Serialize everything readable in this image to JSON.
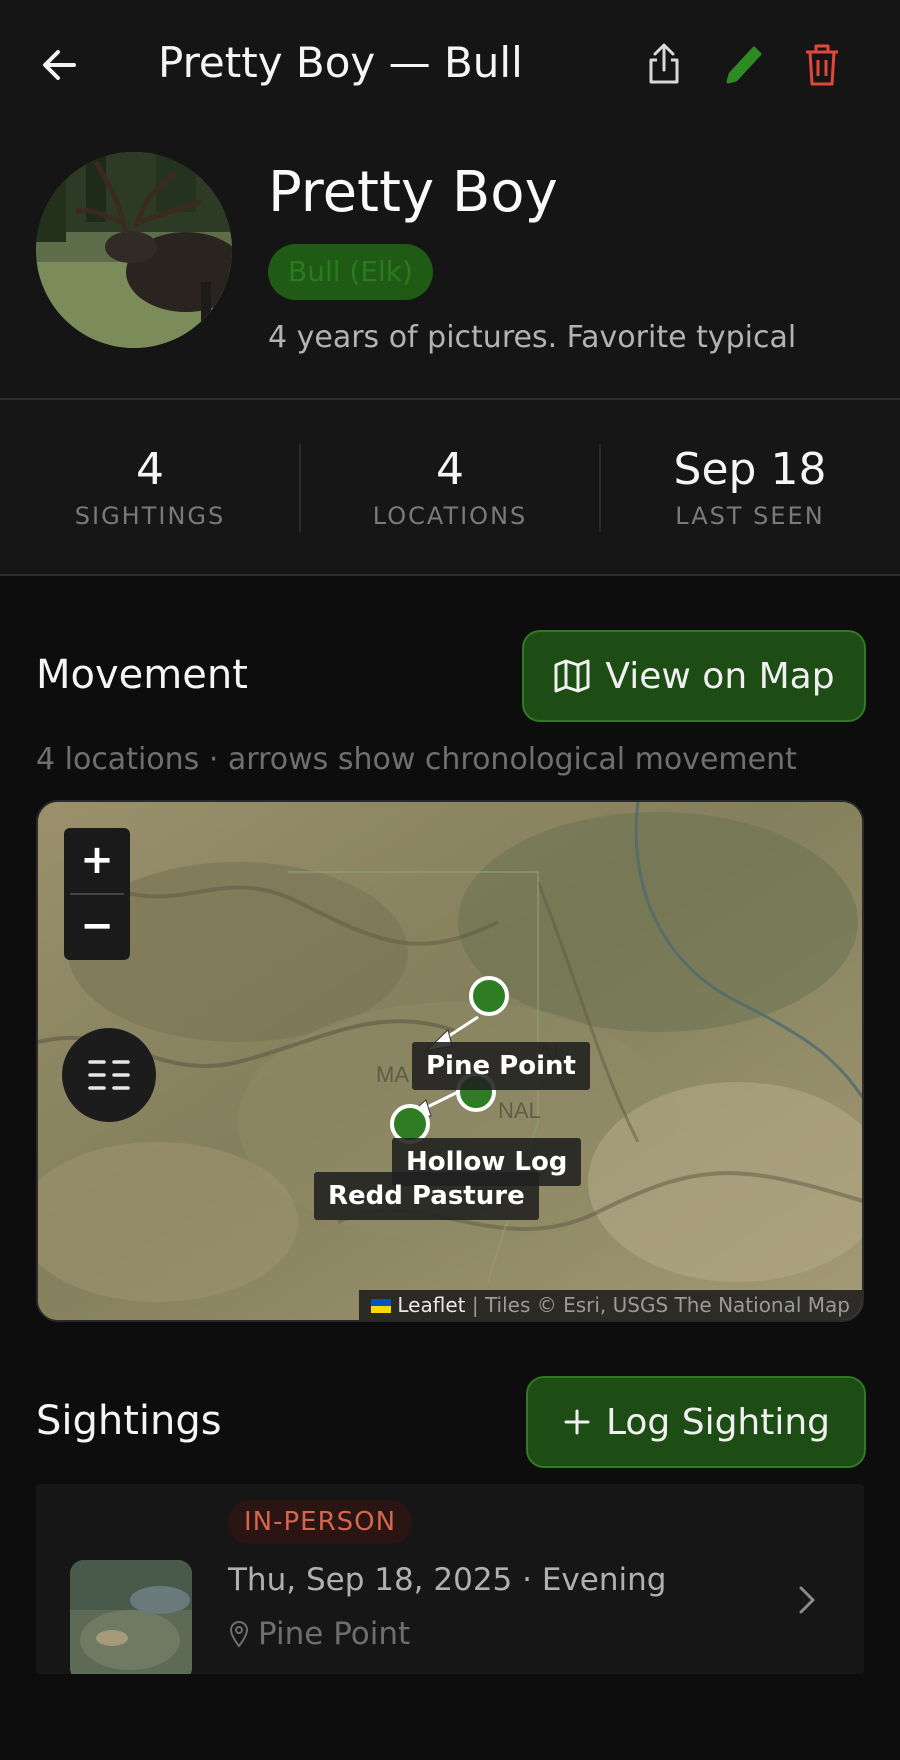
{
  "header": {
    "title": "Pretty Boy — Bull",
    "back_icon": "arrow-left-icon",
    "share_icon": "share-icon",
    "edit_icon": "pencil-icon",
    "delete_icon": "trash-icon"
  },
  "profile": {
    "name": "Pretty Boy",
    "type_badge": "Bull (Elk)",
    "description": "4 years of pictures. Favorite typical"
  },
  "stats": [
    {
      "value": "4",
      "label": "SIGHTINGS"
    },
    {
      "value": "4",
      "label": "LOCATIONS"
    },
    {
      "value": "Sep 18",
      "label": "LAST SEEN"
    }
  ],
  "movement": {
    "title": "Movement",
    "view_map_label": "View on Map",
    "subtitle": "4 locations · arrows show chronological movement",
    "zoom_in": "+",
    "zoom_out": "−",
    "map_text_1": "MA",
    "map_text_2": "AL",
    "map_text_3": "NAL",
    "locations": [
      "Pine Point",
      "Hollow Log",
      "Redd Pasture"
    ],
    "attribution_leaflet": "Leaflet",
    "attribution_rest": " | Tiles © Esri, USGS The National Map"
  },
  "sightings": {
    "title": "Sightings",
    "log_label": "Log Sighting",
    "log_icon": "plus-icon",
    "items": [
      {
        "method": "IN-PERSON",
        "date": "Thu, Sep 18, 2025 · Evening",
        "location": "Pine Point"
      }
    ]
  },
  "colors": {
    "accent_green": "#1d4c14",
    "marker_green": "#2e7d23",
    "delete_red": "#e0483a",
    "badge_red": "#d4664f"
  }
}
